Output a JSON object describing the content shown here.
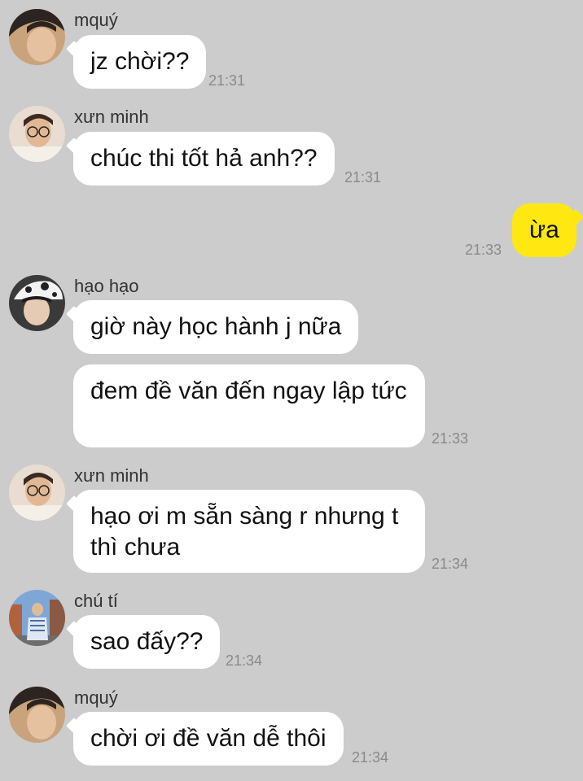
{
  "colors": {
    "background": "#cccccc",
    "incoming_bubble": "#ffffff",
    "outgoing_bubble": "#ffe812",
    "timestamp": "#8a8a8a"
  },
  "messages": [
    {
      "sender": "mquý",
      "avatar_icon": "profile-photo-icon",
      "texts": [
        "jz chời??"
      ],
      "time": "21:31"
    },
    {
      "sender": "xưn minh",
      "avatar_icon": "profile-photo-icon",
      "texts": [
        "chúc thi tốt hả anh??"
      ],
      "time": "21:31"
    },
    {
      "mine": true,
      "texts": [
        "ừa"
      ],
      "time": "21:33"
    },
    {
      "sender": "hạo hạo",
      "avatar_icon": "profile-photo-icon",
      "texts": [
        "giờ này học hành j nữa",
        "đem đề văn đến ngay lập tức"
      ],
      "time": "21:33"
    },
    {
      "sender": "xưn minh",
      "avatar_icon": "profile-photo-icon",
      "texts": [
        "hạo ơi m sẵn sàng r nhưng t thì chưa"
      ],
      "time": "21:34"
    },
    {
      "sender": "chú tí",
      "avatar_icon": "profile-photo-icon",
      "texts": [
        "sao đấy??"
      ],
      "time": "21:34"
    },
    {
      "sender": "mquý",
      "avatar_icon": "profile-photo-icon",
      "texts": [
        "chời ơi đề văn dễ thôi"
      ],
      "time": "21:34"
    }
  ]
}
